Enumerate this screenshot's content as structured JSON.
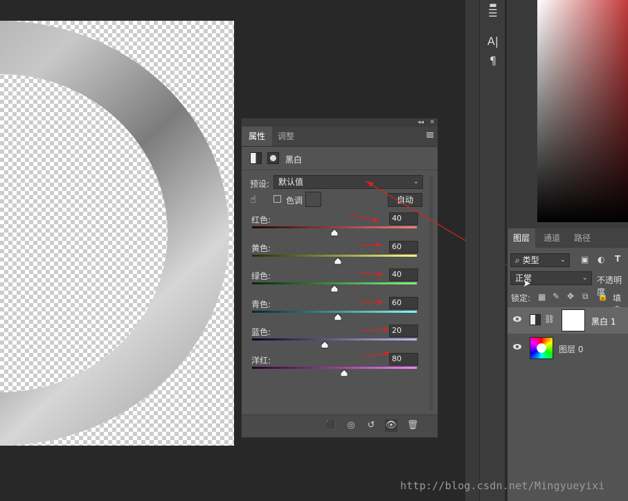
{
  "properties_panel": {
    "tabs": [
      "属性",
      "调整"
    ],
    "adjustment_name": "黑白",
    "preset_label": "预设:",
    "preset_value": "默认值",
    "tint_label": "色调",
    "auto_button": "自动",
    "sliders": [
      {
        "label": "红色:",
        "value": "40",
        "level": 0.5,
        "color_from": "#2a0000",
        "color_to": "#ff8080"
      },
      {
        "label": "黄色:",
        "value": "60",
        "level": 0.52,
        "color_from": "#2a2a00",
        "color_to": "#ffff80"
      },
      {
        "label": "绿色:",
        "value": "40",
        "level": 0.5,
        "color_from": "#002a00",
        "color_to": "#80ff80"
      },
      {
        "label": "青色:",
        "value": "60",
        "level": 0.52,
        "color_from": "#002a2a",
        "color_to": "#80ffff"
      },
      {
        "label": "蓝色:",
        "value": "20",
        "level": 0.44,
        "color_from": "#00002a",
        "color_to": "#c0c0ff"
      },
      {
        "label": "洋红:",
        "value": "80",
        "level": 0.56,
        "color_from": "#2a002a",
        "color_to": "#ff80ff"
      }
    ]
  },
  "layers_panel": {
    "tabs": [
      "图层",
      "通道",
      "路径"
    ],
    "filter_label": "类型",
    "blend_mode": "正常",
    "opacity_label": "不透明度",
    "lock_label": "锁定:",
    "fill_label": "填充",
    "layers": [
      {
        "name": "黑白 1"
      },
      {
        "name": "图层 0"
      }
    ]
  },
  "watermark": "http://blog.csdn.net/Mingyueyixi"
}
